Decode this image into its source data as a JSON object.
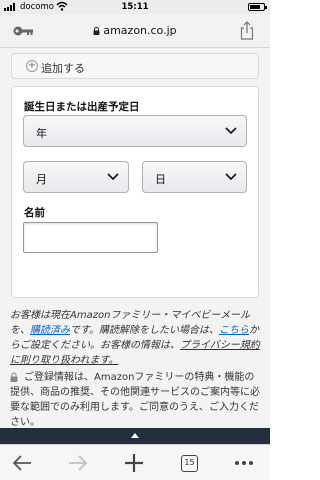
{
  "status_bar": {
    "carrier": "docomo",
    "time": "15:11"
  },
  "url_bar": {
    "address": "amazon.co.jp"
  },
  "add_section": {
    "label": "追加する"
  },
  "birthday_form": {
    "title": "誕生日または出産予定日",
    "year_select": "年",
    "month_select": "月",
    "day_select": "日",
    "name_label": "名前",
    "name_value": ""
  },
  "notice": {
    "text_1": "お客様は現在Amazonファミリー・マイベビーメールを、",
    "link_subscribed": "購読済み",
    "text_2": "です。購読解除をしたい場合は、",
    "link_here": "こちら",
    "text_3": "からご設定ください。お客様の情報は、",
    "link_privacy": "プライバシー規約に則り取り扱われます。"
  },
  "privacy_text": "ご登録情報は、Amazonファミリーの特典・機能の提供、商品の推奨、その他関連サービスのご案内等に必要な範囲でのみ利用します。ご同意のうえ、ご入力ください。",
  "toolbar": {
    "tab_count": "15"
  },
  "colors": {
    "link": "#0066c0",
    "footer": "#232f3e"
  }
}
